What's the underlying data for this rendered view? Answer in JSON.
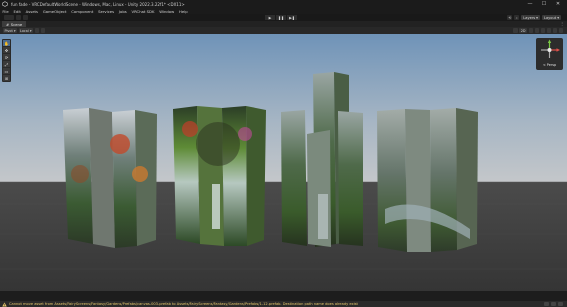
{
  "window": {
    "title": "fun fade - VRCDefaultWorldScene - Windows, Mac, Linux - Unity 2022.3.22f1* <DX11>",
    "minimize": "—",
    "maximize": "☐",
    "close": "✕"
  },
  "menu": [
    "File",
    "Edit",
    "Assets",
    "GameObject",
    "Component",
    "Services",
    "Jobs",
    "VRChat SDK",
    "Window",
    "Help"
  ],
  "toolbar": {
    "play": "▶",
    "pause": "❚❚",
    "step": "▶❚",
    "layers_label": "Layers",
    "layout_label": "Layout"
  },
  "scene_tab": {
    "label": "Scene",
    "menu": "⋮"
  },
  "scene_toolbar": {
    "pivot_label": "Pivot",
    "space_label": "Local",
    "shading_label": "2D"
  },
  "tools": [
    "✋",
    "✥",
    "⟳",
    "⤢",
    "▭",
    "⊞"
  ],
  "gizmo": {
    "projection_label": "< Persp"
  },
  "status": {
    "message": "Cannot move asset from Assets/FairyScreens/Fantasy/Gardens/Prefabs/canvas-003-prefab to Assets/FairyScreens/Fantasy/Gardens/Prefabs/1-12.prefab. Destination path name does already exist"
  },
  "colors": {
    "accent_warning": "#e6c66b",
    "sky_top": "#6f93b8",
    "ground": "#3a3a3a"
  }
}
